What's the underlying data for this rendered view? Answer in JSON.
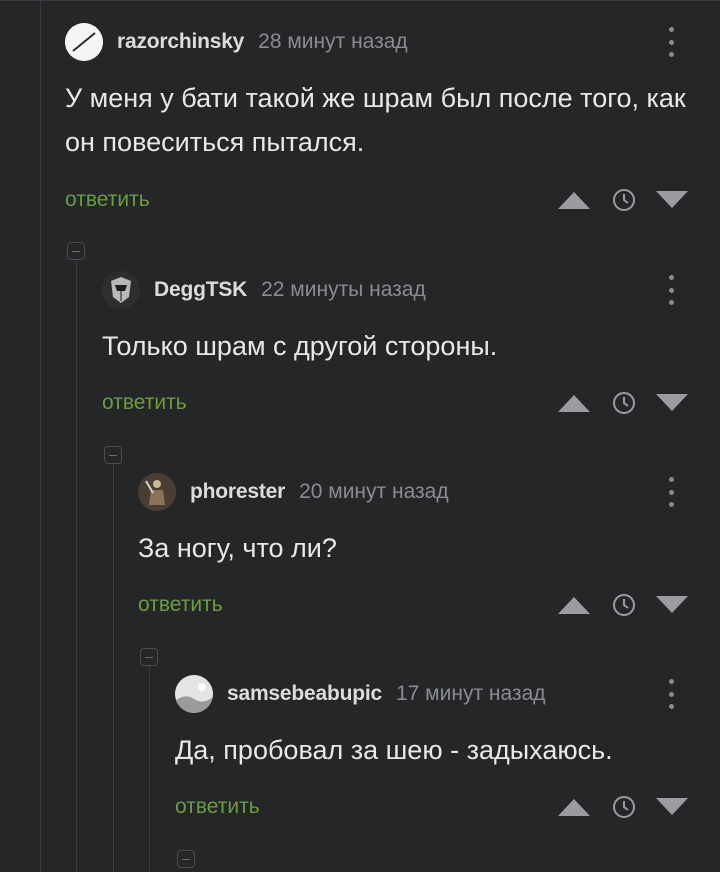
{
  "comments": [
    {
      "username": "razorchinsky",
      "time": "28 минут назад",
      "text": "У меня у бати такой же шрам был после того, как он повеситься пытался.",
      "reply_label": "ответить",
      "avatar_icon": "white-circle-slash-avatar"
    },
    {
      "username": "DeggTSK",
      "time": "22 минуты назад",
      "text": "Только шрам с другой стороны.",
      "reply_label": "ответить",
      "avatar_icon": "armored-helmet-avatar"
    },
    {
      "username": "phorester",
      "time": "20 минут назад",
      "text": "За ногу, что ли?",
      "reply_label": "ответить",
      "avatar_icon": "warrior-figure-avatar"
    },
    {
      "username": "samsebeabupic",
      "time": "17 минут назад",
      "text": "Да, пробовал за шею - задыхаюсь.",
      "reply_label": "ответить",
      "avatar_icon": "gray-landscape-avatar"
    }
  ],
  "colors": {
    "background": "#242628",
    "reply_link": "#6a9d3e",
    "muted": "#8a8c90",
    "text": "#e8e8e8"
  },
  "icons": [
    "vote-up-icon",
    "clock-icon",
    "vote-down-icon",
    "more-vertical-icon",
    "collapse-thread-icon"
  ]
}
